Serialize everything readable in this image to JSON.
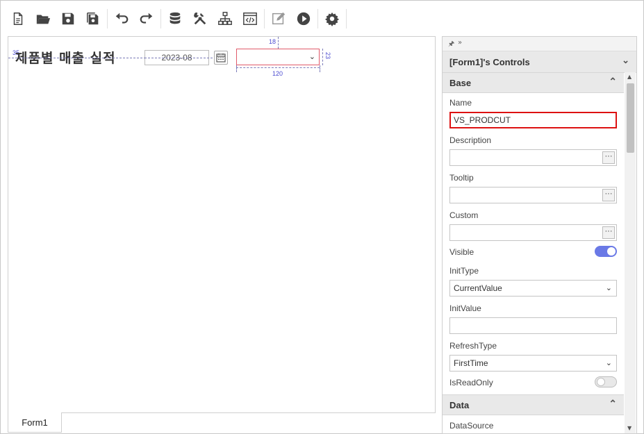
{
  "toolbar": {
    "items": [
      {
        "icon": "new-file-icon"
      },
      {
        "icon": "open-folder-icon"
      },
      {
        "icon": "save-icon"
      },
      {
        "icon": "save-all-icon"
      },
      {
        "icon": "undo-icon"
      },
      {
        "icon": "redo-icon"
      },
      {
        "icon": "database-icon"
      },
      {
        "icon": "tools-icon"
      },
      {
        "icon": "hierarchy-icon"
      },
      {
        "icon": "code-icon"
      },
      {
        "icon": "edit-icon"
      },
      {
        "icon": "run-icon"
      },
      {
        "icon": "settings-icon"
      }
    ]
  },
  "canvas": {
    "title": "제품별 매출 실적",
    "date_value": "2023-08",
    "guide_left": "35",
    "dim_top": "18",
    "dim_width": "120",
    "dim_height": "23"
  },
  "tabs": {
    "form1": "Form1"
  },
  "panel": {
    "header": "[Form1]'s Controls",
    "sections": {
      "base": "Base",
      "data": "Data"
    },
    "props": {
      "name_label": "Name",
      "name_value": "VS_PRODCUT",
      "description_label": "Description",
      "tooltip_label": "Tooltip",
      "custom_label": "Custom",
      "visible_label": "Visible",
      "visible_on": true,
      "inittype_label": "InitType",
      "inittype_value": "CurrentValue",
      "initvalue_label": "InitValue",
      "refreshtype_label": "RefreshType",
      "refreshtype_value": "FirstTime",
      "isreadonly_label": "IsReadOnly",
      "isreadonly_on": false,
      "datasource_label": "DataSource"
    },
    "ellipsis": "···"
  },
  "colors": {
    "toggle_on": "#6a79e6",
    "active_border": "#dd1111",
    "selected_control_border": "#e05a6a",
    "guide": "#4b4bd0"
  }
}
